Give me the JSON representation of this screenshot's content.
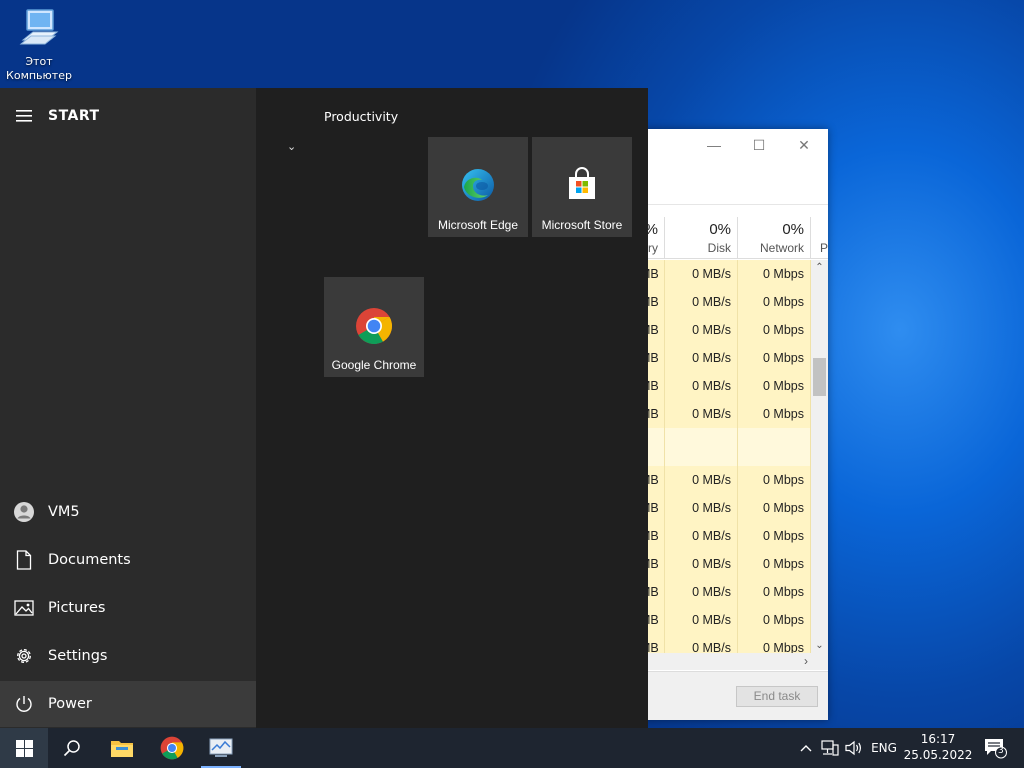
{
  "desktop": {
    "icon_label_line1": "Этот",
    "icon_label_line2": "Компьютер"
  },
  "start_menu": {
    "title": "START",
    "user": "VM5",
    "items": {
      "documents": "Documents",
      "pictures": "Pictures",
      "settings": "Settings",
      "power": "Power"
    },
    "group_label": "Productivity",
    "tiles": {
      "edge": "Microsoft Edge",
      "store": "Microsoft Store",
      "chrome": "Google Chrome"
    }
  },
  "task_manager": {
    "headers": {
      "memory_pct": "%",
      "memory_lbl": "ry",
      "disk_pct": "0%",
      "disk_lbl": "Disk",
      "network_pct": "0%",
      "network_lbl": "Network",
      "power_lbl": "P"
    },
    "rows": [
      {
        "mem": "MB",
        "disk": "0 MB/s",
        "net": "0 Mbps"
      },
      {
        "mem": "MB",
        "disk": "0 MB/s",
        "net": "0 Mbps"
      },
      {
        "mem": "MB",
        "disk": "0 MB/s",
        "net": "0 Mbps"
      },
      {
        "mem": "MB",
        "disk": "0 MB/s",
        "net": "0 Mbps"
      },
      {
        "mem": "MB",
        "disk": "0 MB/s",
        "net": "0 Mbps"
      },
      {
        "mem": "MB",
        "disk": "0 MB/s",
        "net": "0 Mbps"
      },
      {
        "mem": "",
        "disk": "",
        "net": ""
      },
      {
        "mem": "MB",
        "disk": "0 MB/s",
        "net": "0 Mbps"
      },
      {
        "mem": "MB",
        "disk": "0 MB/s",
        "net": "0 Mbps"
      },
      {
        "mem": "MB",
        "disk": "0 MB/s",
        "net": "0 Mbps"
      },
      {
        "mem": "MB",
        "disk": "0 MB/s",
        "net": "0 Mbps"
      },
      {
        "mem": "MB",
        "disk": "0 MB/s",
        "net": "0 Mbps"
      },
      {
        "mem": "MB",
        "disk": "0 MB/s",
        "net": "0 Mbps"
      },
      {
        "mem": "MB",
        "disk": "0 MB/s",
        "net": "0 Mbps"
      }
    ],
    "end_task": "End task"
  },
  "taskbar": {
    "language": "ENG",
    "time": "16:17",
    "date": "25.05.2022",
    "notification_count": "3"
  },
  "colors": {
    "row_highlight": "#fff4c4",
    "start_bg": "#1f1f1f",
    "rail_bg": "#2b2b2b",
    "tile_bg": "#3a3a3a",
    "taskbar_bg": "#1e2530"
  }
}
